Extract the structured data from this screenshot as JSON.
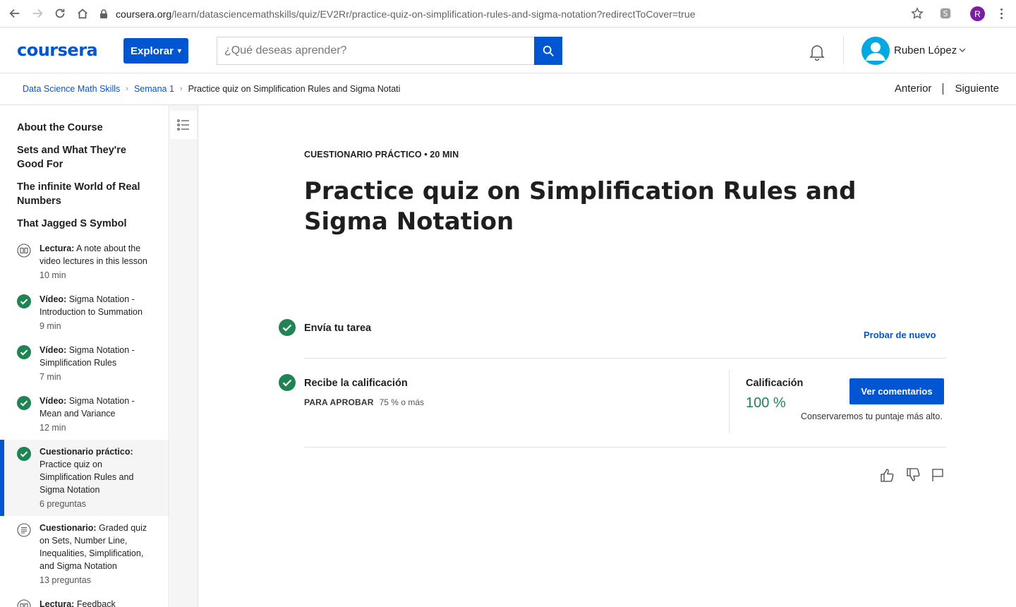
{
  "browser": {
    "url_host": "coursera.org",
    "url_path": "/learn/datasciencemathskills/quiz/EV2Rr/practice-quiz-on-simplification-rules-and-sigma-notation?redirectToCover=true",
    "profile_initial": "R"
  },
  "header": {
    "logo": "coursera",
    "explore_label": "Explorar",
    "search_placeholder": "¿Qué deseas aprender?",
    "user_name": "Ruben López"
  },
  "breadcrumb": {
    "items": [
      "Data Science Math Skills",
      "Semana 1"
    ],
    "current": "Practice quiz on Simplification Rules and Sigma Notatio"
  },
  "pager": {
    "prev": "Anterior",
    "next": "Siguiente"
  },
  "sidebar": {
    "sections": [
      "About the Course",
      "Sets and What They're Good For",
      "The infinite World of Real Numbers",
      "That Jagged S Symbol"
    ],
    "items": [
      {
        "type": "Lectura:",
        "title": "A note about the video lectures in this lesson",
        "meta": "10 min",
        "icon": "book-icon",
        "done": false
      },
      {
        "type": "Vídeo:",
        "title": "Sigma Notation - Introduction to Summation",
        "meta": "9 min",
        "icon": "check-icon",
        "done": true
      },
      {
        "type": "Vídeo:",
        "title": "Sigma Notation - Simplification Rules",
        "meta": "7 min",
        "icon": "check-icon",
        "done": true
      },
      {
        "type": "Vídeo:",
        "title": "Sigma Notation - Mean and Variance",
        "meta": "12 min",
        "icon": "check-icon",
        "done": true
      },
      {
        "type": "Cuestionario práctico:",
        "title": "Practice quiz on Simplification Rules and Sigma Notation",
        "meta": "6 preguntas",
        "icon": "check-icon",
        "done": true,
        "active": true
      },
      {
        "type": "Cuestionario:",
        "title": "Graded quiz on Sets, Number Line, Inequalities, Simplification, and Sigma Notation",
        "meta": "13 preguntas",
        "icon": "quiz-icon",
        "done": false
      },
      {
        "type": "Lectura:",
        "title": "Feedback",
        "meta": "",
        "icon": "book-icon",
        "done": false
      }
    ]
  },
  "main": {
    "kicker": "CUESTIONARIO PRÁCTICO • 20 MIN",
    "title": "Practice quiz on Simplification Rules and Sigma Notation",
    "step1_label": "Envía tu tarea",
    "retry_label": "Probar de nuevo",
    "step2_label": "Recibe la calificación",
    "pass_label": "PARA APROBAR",
    "pass_value": "75 % o más",
    "grade_label": "Calificación",
    "grade_value": "100 %",
    "feedback_button": "Ver comentarios",
    "keep_note": "Conservaremos tu puntaje más alto."
  },
  "colors": {
    "brand": "#0056d2",
    "success": "#1f8354"
  }
}
